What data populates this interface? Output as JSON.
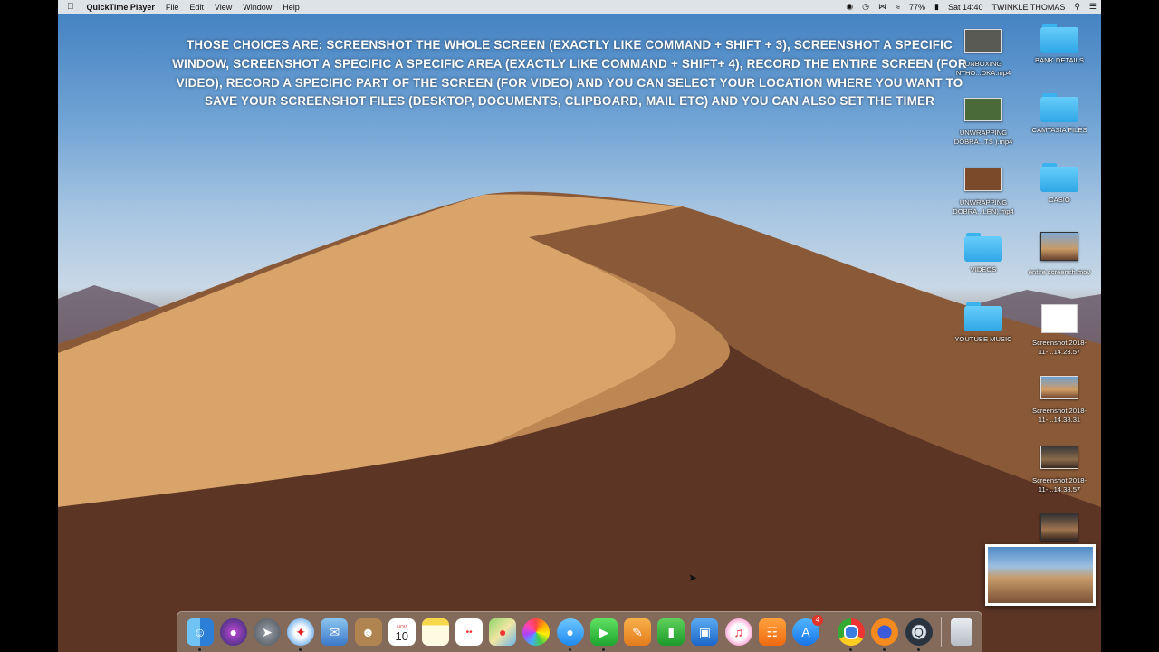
{
  "menubar": {
    "app_name": "QuickTime Player",
    "menus": [
      "File",
      "Edit",
      "View",
      "Window",
      "Help"
    ],
    "battery": "77%",
    "clock": "Sat 14:40",
    "user": "TWINKLE THOMAS"
  },
  "overlay": {
    "text": "THOSE CHOICES ARE: SCREENSHOT THE WHOLE SCREEN (EXACTLY LIKE COMMAND + SHIFT + 3), SCREENSHOT A SPECIFIC WINDOW, SCREENSHOT A SPECIFIC A SPECIFIC AREA (EXACTLY LIKE COMMAND + SHIFT+ 4), RECORD THE ENTIRE SCREEN (FOR VIDEO), RECORD A SPECIFIC PART OF THE SCREEN (FOR VIDEO) AND YOU CAN SELECT YOUR LOCATION WHERE YOU WANT TO SAVE YOUR SCREENSHOT FILES (DESKTOP, DOCUMENTS, CLIPBOARD, MAIL ETC) AND YOU CAN ALSO SET THE TIMER"
  },
  "desktop": {
    "left_column": [
      {
        "label": "UNBOXING NTHO...DKA.mp4",
        "kind": "video"
      },
      {
        "label": "UNWRAPPING DOBRA...TS ).mp4",
        "kind": "video"
      },
      {
        "label": "UNWRAPPING DOBRA...LEN).mp4",
        "kind": "video"
      },
      {
        "label": "VIDEOS",
        "kind": "folder"
      },
      {
        "label": "YOUTUBE MUSIC",
        "kind": "folder"
      }
    ],
    "right_column": [
      {
        "label": "BANK DETAILS",
        "kind": "folder"
      },
      {
        "label": "CAMTASIA FILES",
        "kind": "folder"
      },
      {
        "label": "CASIO",
        "kind": "folder"
      },
      {
        "label": "entire screensh.mov",
        "kind": "video"
      },
      {
        "label": "Screenshot 2018-11-...14.23.57",
        "kind": "document"
      },
      {
        "label": "Screenshot 2018-11-...14.38.31",
        "kind": "image"
      },
      {
        "label": "Screenshot 2018-11-...14.38.57",
        "kind": "image"
      },
      {
        "label": "",
        "kind": "image"
      }
    ]
  },
  "dock": {
    "calendar_month": "NOV",
    "calendar_day": "10",
    "app_store_badge": "4"
  }
}
